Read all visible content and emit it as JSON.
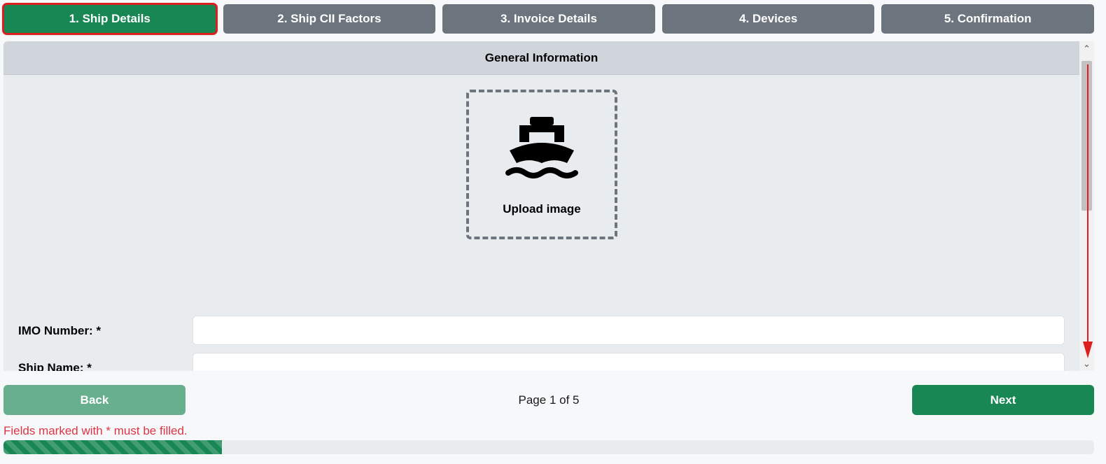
{
  "steps": [
    {
      "label": "1. Ship Details",
      "active": true
    },
    {
      "label": "2. Ship CII Factors",
      "active": false
    },
    {
      "label": "3. Invoice Details",
      "active": false
    },
    {
      "label": "4. Devices",
      "active": false
    },
    {
      "label": "5. Confirmation",
      "active": false
    }
  ],
  "panel": {
    "title": "General Information",
    "upload_label": "Upload image",
    "upload_icon": "ship-icon"
  },
  "form": {
    "fields": [
      {
        "label": "IMO Number: *",
        "value": ""
      },
      {
        "label": "Ship Name: *",
        "value": ""
      }
    ]
  },
  "footer": {
    "back_label": "Back",
    "next_label": "Next",
    "page_indicator": "Page 1 of 5",
    "warning": "Fields marked with * must be filled.",
    "progress_percent": 20
  },
  "colors": {
    "primary": "#198754",
    "primary_disabled": "#68af8d",
    "inactive_step": "#6c757d",
    "warning": "#dc3545",
    "annotation": "#dc1e1e"
  }
}
